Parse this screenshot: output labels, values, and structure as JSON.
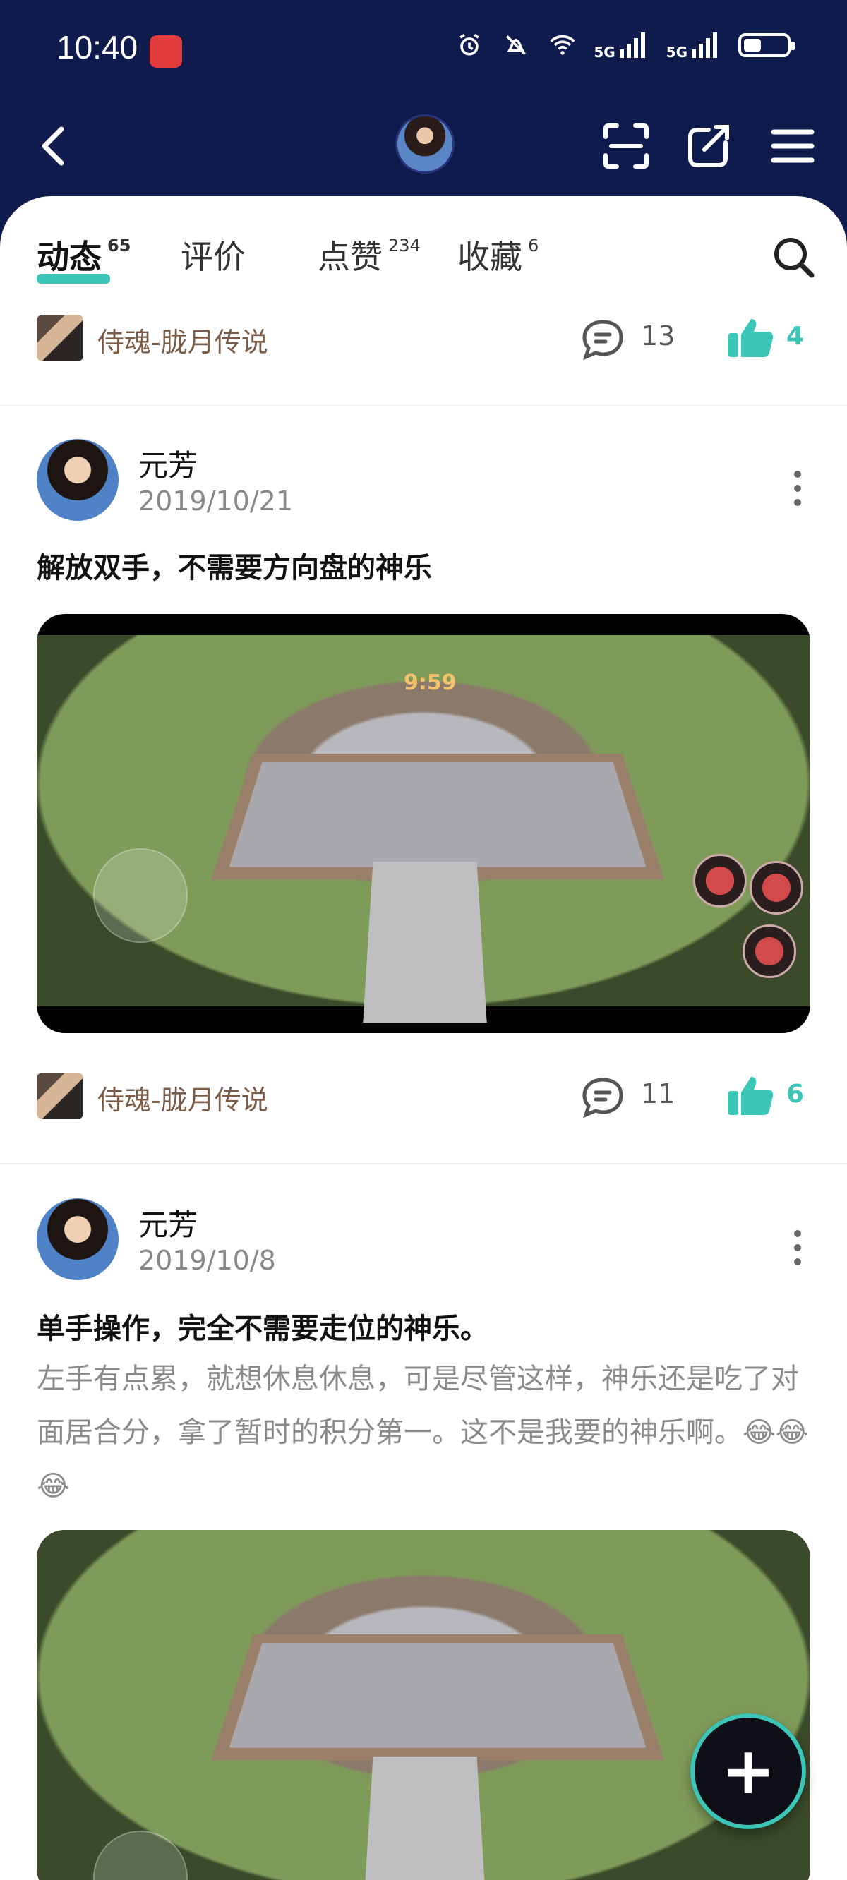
{
  "status_bar": {
    "time": "10:40",
    "network_1": "5G",
    "network_2": "5G"
  },
  "nav": {
    "back_icon": "back-icon",
    "scan_icon": "scan-icon",
    "share_icon": "share-icon",
    "menu_icon": "menu-icon"
  },
  "tabs": [
    {
      "label": "动态",
      "count": "65"
    },
    {
      "label": "评价",
      "count": ""
    },
    {
      "label": "点赞",
      "count": "234"
    },
    {
      "label": "收藏",
      "count": "6"
    }
  ],
  "posts": [
    {
      "game_name": "侍魂-胧月传说",
      "comments": "13",
      "likes": "4"
    },
    {
      "author": "元芳",
      "date": "2019/10/21",
      "title": "解放双手，不需要方向盘的神乐",
      "video": {
        "timer": "9:59"
      },
      "game_name": "侍魂-胧月传说",
      "comments": "11",
      "likes": "6"
    },
    {
      "author": "元芳",
      "date": "2019/10/8",
      "title": "单手操作，完全不需要走位的神乐。",
      "body": "左手有点累，就想休息休息，可是尽管这样，神乐还是吃了对面居合分，拿了暂时的积分第一。这不是我要的神乐啊。😂😂😂"
    }
  ],
  "fab": {
    "label": "+"
  },
  "colors": {
    "header_bg": "#0f1a4d",
    "accent": "#3cc6b8"
  }
}
